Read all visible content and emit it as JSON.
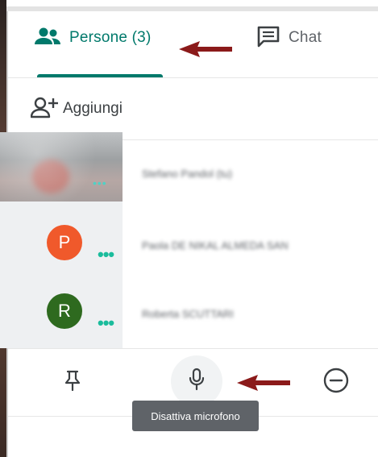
{
  "tabs": {
    "people_label": "Persone (3)",
    "chat_label": "Chat"
  },
  "add": {
    "label": "Aggiungi"
  },
  "participants": [
    {
      "name": "Stefano Pandol (tu)",
      "type": "video"
    },
    {
      "name": "Paola DE NIKAL ALMEDA SAN",
      "initial": "P",
      "color": "#f0592b"
    },
    {
      "name": "Roberta SCUTTARI",
      "initial": "R",
      "color": "#2e6a1f"
    }
  ],
  "video_dots": "•••",
  "dots": "•••",
  "tooltip": {
    "text": "Disattiva microfono"
  },
  "colors": {
    "accent": "#00796b",
    "arrow": "#8b1a1a",
    "tooltip_bg": "#5f6368"
  },
  "icons": [
    "people-icon",
    "chat-icon",
    "add-person-icon",
    "pin-icon",
    "microphone-icon",
    "minus-circle-icon",
    "arrow-icon"
  ]
}
